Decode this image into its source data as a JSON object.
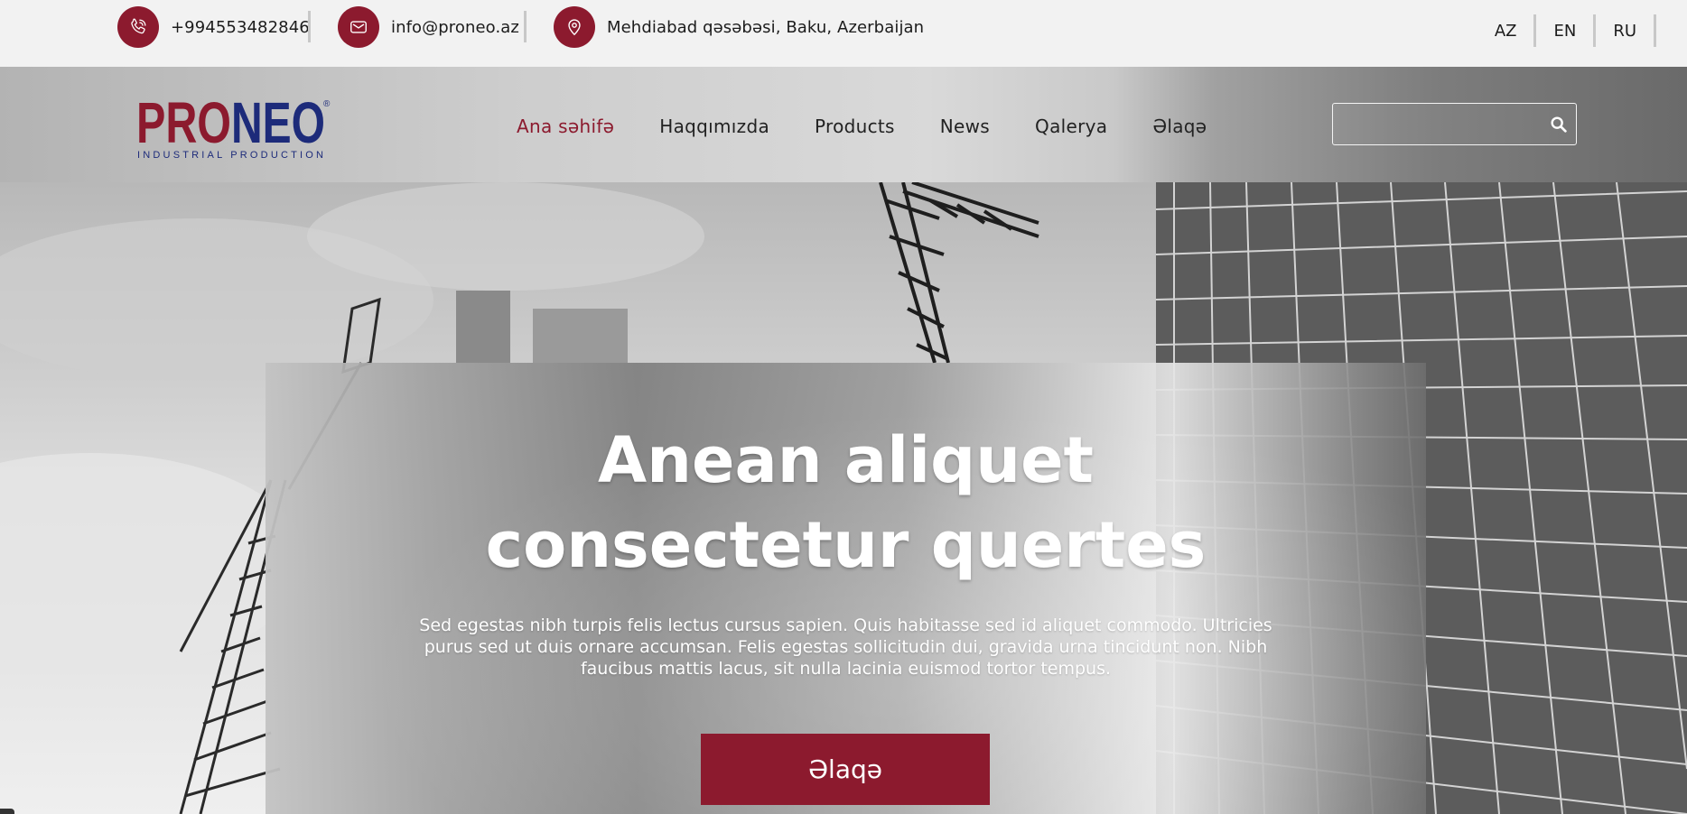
{
  "topbar": {
    "phone": "+994553482846",
    "email": "info@proneo.az",
    "address": "Mehdiabad qəsəbəsi, Baku, Azerbaijan",
    "languages": [
      "AZ",
      "EN",
      "RU"
    ]
  },
  "logo": {
    "brand_part1": "PRO",
    "brand_part2": "NEO",
    "tagline": "INDUSTRIAL PRODUCTION",
    "registered": "®"
  },
  "nav": {
    "items": [
      {
        "label": "Ana səhifə",
        "active": true
      },
      {
        "label": "Haqqımızda",
        "active": false
      },
      {
        "label": "Products",
        "active": false
      },
      {
        "label": "News",
        "active": false
      },
      {
        "label": "Qalerya",
        "active": false
      },
      {
        "label": "Əlaqə",
        "active": false
      }
    ]
  },
  "search": {
    "placeholder": "",
    "value": ""
  },
  "hero": {
    "title_line1": "Anean aliquet",
    "title_line2": "consectetur quertes",
    "subtitle": "Sed egestas nibh turpis felis lectus cursus sapien. Quis habitasse sed id aliquet commodo. Ultricies purus sed ut duis ornare accumsan. Felis egestas sollicitudin dui, gravida urna tincidunt non. Nibh faucibus mattis lacus, sit nulla lacinia euismod tortor tempus.",
    "cta_label": "Əlaqə"
  },
  "colors": {
    "brand_red": "#8c1a2e",
    "brand_blue": "#1d2b7a"
  }
}
